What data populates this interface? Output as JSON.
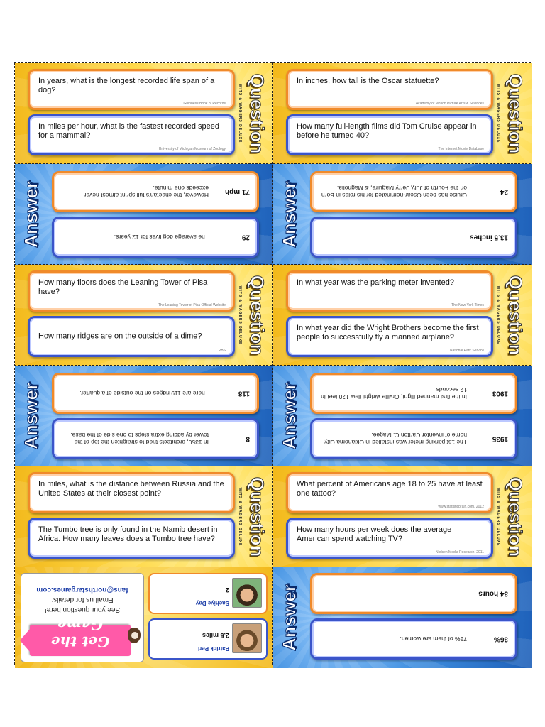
{
  "labels": {
    "question": "Question",
    "answer": "Answer",
    "question_sub": "WITS & WAGERS DELUXE"
  },
  "cards": [
    {
      "question_top": {
        "text": "In years, what is the longest recorded life span of a dog?",
        "source": "Guinness Book of Records"
      },
      "question_bottom": {
        "text": "In miles per hour, what is the fastest recorded speed for a mammal?",
        "source": "University of Michigan Museum of Zoology"
      },
      "answer_top": {
        "value": "71 mph",
        "explanation": "However, the cheetah's full sprint almost never exceeds one minute."
      },
      "answer_bottom": {
        "value": "29",
        "explanation": "The average dog lives for 12 years."
      }
    },
    {
      "question_top": {
        "text": "In inches, how tall is the Oscar statuette?",
        "source": "Academy of Motion Picture Arts & Sciences"
      },
      "question_bottom": {
        "text": "How many full-length films did Tom Cruise appear in before he turned 40?",
        "source": "The Internet Movie Database"
      },
      "answer_top": {
        "value": "24",
        "explanation": "Cruise has been Oscar-nominated for his roles in Born on the Fourth of July, Jerry Maguire, & Magnolia."
      },
      "answer_bottom": {
        "value": "13.5 inches",
        "explanation": ""
      }
    },
    {
      "question_top": {
        "text": "How many floors does the Leaning Tower of Pisa have?",
        "source": "The Leaning Tower of Pisa Official Website"
      },
      "question_bottom": {
        "text": "How many ridges are on the outside of a dime?",
        "source": "PBS"
      },
      "answer_top": {
        "value": "118",
        "explanation": "There are 119 ridges on the outside of a quarter."
      },
      "answer_bottom": {
        "value": "8",
        "explanation": "In 1350, architects tried to straighten the top of the tower by adding extra steps to one side of the base."
      }
    },
    {
      "question_top": {
        "text": "In what year was the parking meter invented?",
        "source": "The New York Times"
      },
      "question_bottom": {
        "text": "In what year did the Wright Brothers become the first people to successfully fly a manned airplane?",
        "source": "National Park Service"
      },
      "answer_top": {
        "value": "1903",
        "explanation": "In the first manned flight, Orville Wright flew 120 feet in 12 seconds."
      },
      "answer_bottom": {
        "value": "1935",
        "explanation": "The 1st parking meter was installed in Oklahoma City, home of inventor Carlton C. Magee."
      }
    },
    {
      "question_top": {
        "text": "In miles, what is the distance between Russia and the United States at their closest point?",
        "source": ""
      },
      "question_bottom": {
        "text": "The Tumbo tree is only found in the Namib desert in Africa. How many leaves does a Tumbo tree have?",
        "source": ""
      }
    },
    {
      "question_top": {
        "text": "What percent of Americans age 18 to 25 have at least one tattoo?",
        "source": "www.statisticbrain.com, 2012"
      },
      "question_bottom": {
        "text": "How many hours per week does the average American spend watching TV?",
        "source": "Nielsen Media Research, 2011"
      },
      "answer_top": {
        "value": "34 hours",
        "explanation": ""
      },
      "answer_bottom": {
        "value": "36%",
        "explanation": "75% of them are women."
      }
    }
  ],
  "promo": {
    "logo": "Get the Game",
    "line1": "See your question here!",
    "line2": "Email us for details:",
    "email": "fans@northstargames.com"
  },
  "players": [
    {
      "name": "Sachiye Day",
      "answer": "2"
    },
    {
      "name": "Patrick Perl",
      "answer": "2.5 miles"
    }
  ],
  "colors": {
    "question_bg": "#ffd94a",
    "answer_bg": "#3f8fe0",
    "orange_border": "#f08a2a",
    "blue_border": "#3b55c9"
  }
}
